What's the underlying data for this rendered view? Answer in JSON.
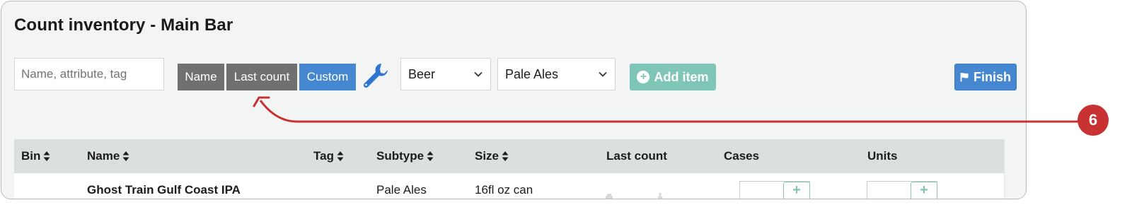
{
  "page": {
    "title": "Count inventory - Main Bar"
  },
  "search": {
    "placeholder": "Name, attribute, tag",
    "value": ""
  },
  "sort_buttons": [
    {
      "label": "Name",
      "active": false
    },
    {
      "label": "Last count",
      "active": false
    },
    {
      "label": "Custom",
      "active": true
    }
  ],
  "tools": {
    "icon": "wrench-icon"
  },
  "filters": {
    "category": {
      "selected": "Beer"
    },
    "subtype": {
      "selected": "Pale Ales"
    }
  },
  "actions": {
    "add_item_label": "Add item",
    "finish_label": "Finish"
  },
  "table": {
    "columns": [
      "Bin",
      "Name",
      "Tag",
      "Subtype",
      "Size",
      "Last count",
      "Cases",
      "Units"
    ],
    "rows": [
      {
        "bin": "",
        "name": "Ghost Train Gulf Coast IPA",
        "tag": "",
        "subtype": "Pale Ales",
        "size": "16fl oz can",
        "last_count": "",
        "cases": "",
        "units": ""
      }
    ]
  },
  "annotation": {
    "badge": "6"
  },
  "colors": {
    "accent_blue": "#4587d0",
    "sort_gray": "#707070",
    "add_green": "#7fc6b6",
    "callout_red": "#c83232"
  }
}
